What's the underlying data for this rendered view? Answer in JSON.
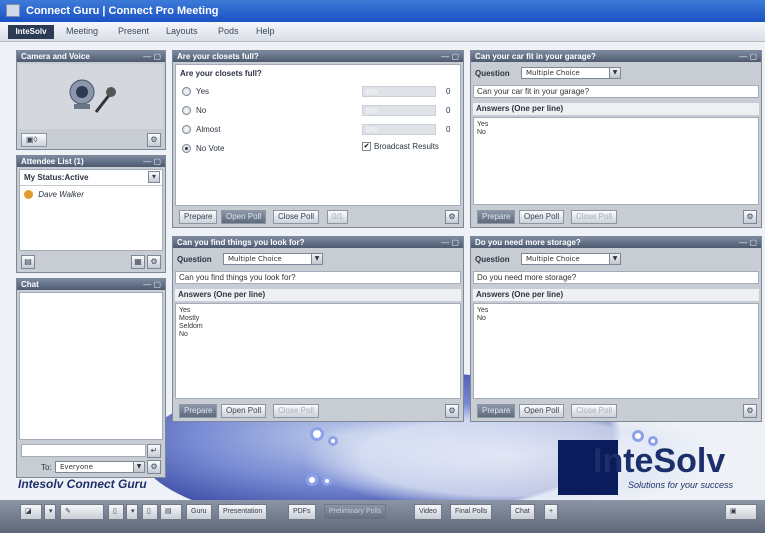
{
  "window": {
    "title": "Connect Guru | Connect Pro Meeting"
  },
  "menubar": {
    "brand": "InteSolv",
    "items": [
      "Meeting",
      "Present",
      "Layouts",
      "Pods",
      "Help"
    ]
  },
  "camera_pod": {
    "title": "Camera and Voice",
    "ctl": "— ▢"
  },
  "attendee_pod": {
    "title": "Attendee List (1)",
    "status": "My Status:Active",
    "attendees": [
      "Dave Walker"
    ],
    "ctl": "— ▢"
  },
  "chat_pod": {
    "title": "Chat",
    "to_label": "To:",
    "to_value": "Everyone",
    "ctl": "— ▢"
  },
  "poll_closets": {
    "title": "Are your closets full?",
    "question": "Are your closets full?",
    "options": [
      {
        "label": "Yes",
        "count": "0",
        "selected": false
      },
      {
        "label": "No",
        "count": "0",
        "selected": false
      },
      {
        "label": "Almost",
        "count": "0",
        "selected": false
      },
      {
        "label": "No Vote",
        "count": "",
        "selected": true
      }
    ],
    "broadcast": "Broadcast Results",
    "buttons": [
      "Prepare",
      "Open Poll",
      "Close Poll",
      "0/1"
    ],
    "ctl": "— ▢"
  },
  "poll_garage": {
    "title": "Can your car fit in your garage?",
    "question_label": "Question",
    "type": "Multiple Choice",
    "question": "Can your car fit in your garage?",
    "answers_label": "Answers (One per line)",
    "answers": [
      "Yes",
      "No"
    ],
    "buttons": [
      "Prepare",
      "Open Poll",
      "Close Poll"
    ],
    "ctl": "— ▢"
  },
  "poll_find": {
    "title": "Can you find things you look for?",
    "question_label": "Question",
    "type": "Multiple Choice",
    "question": "Can you find things you look for?",
    "answers_label": "Answers (One per line)",
    "answers": [
      "Yes",
      "Mostly",
      "Seldom",
      "No"
    ],
    "buttons": [
      "Prepare",
      "Open Poll",
      "Close Poll"
    ],
    "ctl": "— ▢"
  },
  "poll_storage": {
    "title": "Do you need more storage?",
    "question_label": "Question",
    "type": "Multiple Choice",
    "question": "Do you need more storage?",
    "answers_label": "Answers (One per line)",
    "answers": [
      "Yes",
      "No"
    ],
    "buttons": [
      "Prepare",
      "Open Poll",
      "Close Poll"
    ],
    "ctl": "— ▢"
  },
  "branding": {
    "connect_guru": "Intesolv Connect Guru",
    "logo_text": "InteSolv",
    "logo_sub": "Solutions for your success"
  },
  "bottombar": {
    "tabs": [
      "Guru",
      "Presentation",
      "PDFs",
      "Preliminary Polls",
      "Video",
      "Final Polls",
      "Chat",
      "+"
    ]
  },
  "colors": {
    "titlebar": "#1a52c4",
    "panel_header": "#4d5a70",
    "accent": "#1d2f6b"
  }
}
